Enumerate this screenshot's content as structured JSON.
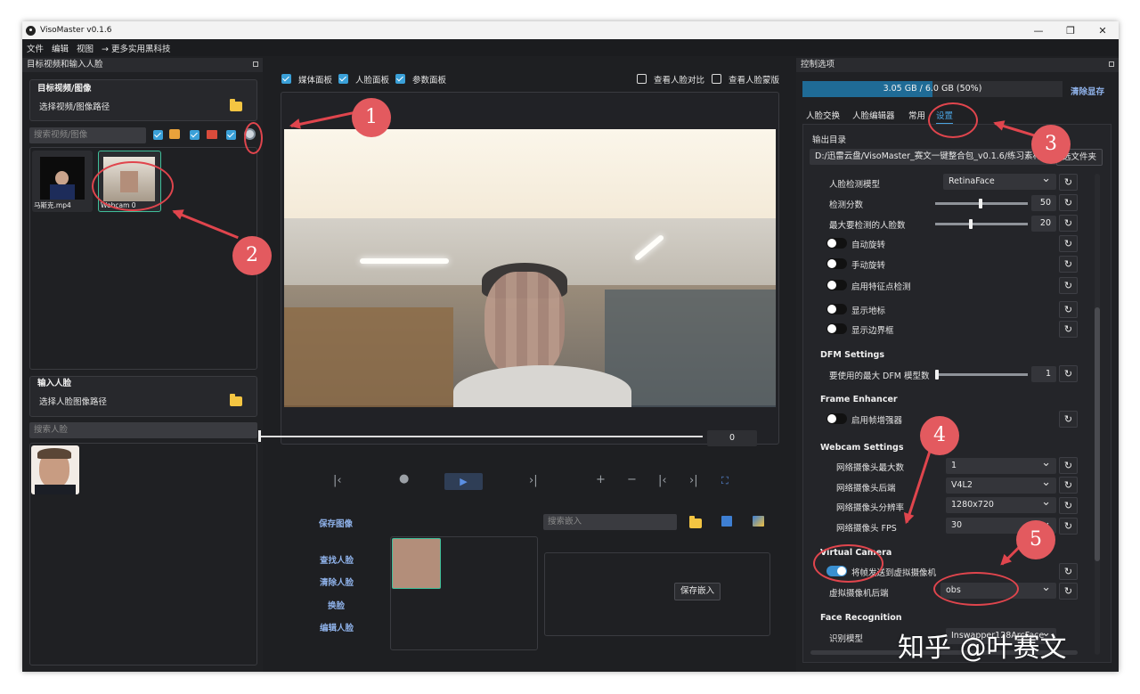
{
  "window": {
    "title": "VisoMaster v0.1.6",
    "controls": {
      "minimize": "—",
      "restore": "❐",
      "close": "✕"
    }
  },
  "menu": [
    "文件",
    "编辑",
    "视图",
    "→ 更多实用黑科技"
  ],
  "left": {
    "header": "目标视频和输入人脸",
    "target": {
      "title": "目标视频/图像",
      "path_label": "选择视频/图像路径"
    },
    "search_target_placeholder": "搜索视频/图像",
    "thumbs": [
      {
        "label": "马斯克.mp4"
      },
      {
        "label": "Webcam 0"
      }
    ],
    "input_faces": {
      "title": "输入人脸",
      "path_label": "选择人脸图像路径"
    },
    "search_face_placeholder": "搜索人脸"
  },
  "center": {
    "panels": [
      "媒体面板",
      "人脸面板",
      "参数面板"
    ],
    "compare": [
      "查看人脸对比",
      "查看人脸蒙版"
    ],
    "frame": "0",
    "save_image": "保存图像",
    "search_embed_placeholder": "搜索嵌入",
    "actions": [
      "查找人脸",
      "清除人脸",
      "换脸",
      "编辑人脸"
    ],
    "save_embed": "保存嵌入"
  },
  "right": {
    "header": "控制选项",
    "memory": {
      "text": "3.05 GB / 6.0 GB (50%)",
      "fraction": 0.5
    },
    "clear_memory": "清除显存",
    "tabs": [
      "人脸交换",
      "人脸编辑器",
      "常用",
      "设置"
    ],
    "output_dir_label": "输出目录",
    "output_dir": "D:/迅雷云盘/VisoMaster_赛文一键整合包_v0.1.6/练习素材",
    "output_btn": "选文件夹",
    "detect_model_label": "人脸检测模型",
    "detect_model": "RetinaFace",
    "detect_score_label": "检测分数",
    "detect_score": "50",
    "max_faces_label": "最大要检测的人脸数",
    "max_faces": "20",
    "auto_rotate": "自动旋转",
    "manual_rotate": "手动旋转",
    "landmark": "启用特征点检测",
    "show_landmarks": "显示地标",
    "show_bbox": "显示边界框",
    "dfm_title": "DFM Settings",
    "dfm_max_label": "要使用的最大 DFM 模型数",
    "dfm_max": "1",
    "frame_enh_title": "Frame Enhancer",
    "frame_enh_label": "启用帧增强器",
    "webcam_title": "Webcam Settings",
    "webcam_max_label": "网络摄像头最大数",
    "webcam_max": "1",
    "webcam_backend_label": "网络摄像头后端",
    "webcam_backend": "V4L2",
    "webcam_res_label": "网络摄像头分辨率",
    "webcam_res": "1280x720",
    "webcam_fps_label": "网络摄像头 FPS",
    "webcam_fps": "30",
    "vcam_title": "Virtual Camera",
    "vcam_send_label": "将帧发送到虚拟摄像机",
    "vcam_backend_label": "虚拟摄像机后端",
    "vcam_backend": "obs",
    "face_rec_title": "Face Recognition",
    "face_rec_model_label": "识别模型",
    "face_rec_model": "Inswapper128ArcFace"
  },
  "annotations": [
    "1",
    "2",
    "3",
    "4",
    "5"
  ],
  "watermark": "知乎 @叶赛文",
  "colors": {
    "accent": "#3aa0d8",
    "annotation": "#e0454d",
    "background": "#1e1f22"
  }
}
